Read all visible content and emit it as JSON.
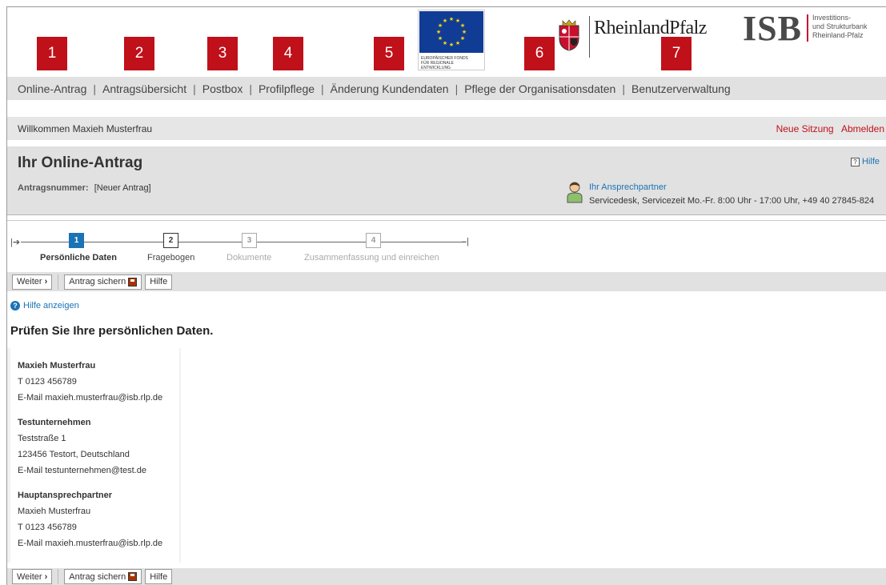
{
  "logos": {
    "eu_text_line1": "EUROPÄISCHER FONDS",
    "eu_text_line2": "FÜR REGIONALE ENTWICKLUNG",
    "rlp_name": "RheinlandPfalz",
    "isb_name": "ISB",
    "isb_sub_line1": "Investitions-",
    "isb_sub_line2": "und Strukturbank",
    "isb_sub_line3": "Rheinland-Pfalz"
  },
  "badges": [
    "1",
    "2",
    "3",
    "4",
    "5",
    "6",
    "7"
  ],
  "nav": {
    "items": [
      "Online-Antrag",
      "Antragsübersicht",
      "Postbox",
      "Profilpflege",
      "Änderung Kundendaten",
      "Pflege der Organisationsdaten",
      "Benutzerverwaltung"
    ],
    "separator": "|"
  },
  "welcome": {
    "text": "Willkommen Maxieh Musterfrau",
    "new_session": "Neue Sitzung",
    "logout": "Abmelden"
  },
  "antrag": {
    "title": "Ihr Online-Antrag",
    "help_label": "Hilfe",
    "number_label": "Antragsnummer:",
    "number_value": "[Neuer Antrag]",
    "contact_label": "Ihr Ansprechpartner",
    "contact_info": "Servicedesk, Servicezeit Mo.-Fr. 8:00 Uhr - 17:00 Uhr, +49 40 27845-824"
  },
  "steps": [
    {
      "num": "1",
      "label": "Persönliche Daten",
      "state": "active"
    },
    {
      "num": "2",
      "label": "Fragebogen",
      "state": "done"
    },
    {
      "num": "3",
      "label": "Dokumente",
      "state": "off"
    },
    {
      "num": "4",
      "label": "Zusammenfassung und einreichen",
      "state": "off"
    }
  ],
  "toolbar": {
    "next_label": "Weiter",
    "next_glyph": "›",
    "save_label": "Antrag sichern",
    "help_label": "Hilfe"
  },
  "help_link": "Hilfe anzeigen",
  "heading": "Prüfen Sie Ihre persönlichen Daten.",
  "person": {
    "name": "Maxieh Musterfrau",
    "phone": "T 0123 456789",
    "email": "E-Mail maxieh.musterfrau@isb.rlp.de"
  },
  "company": {
    "name": "Testunternehmen",
    "street": "Teststraße 1",
    "city": "123456 Testort, Deutschland",
    "email": "E-Mail testunternehmen@test.de"
  },
  "main_contact": {
    "title": "Hauptansprechpartner",
    "name": "Maxieh Musterfrau",
    "phone": "T 0123 456789",
    "email": "E-Mail maxieh.musterfrau@isb.rlp.de"
  },
  "colors": {
    "badge_red": "#c0101a",
    "link_blue": "#1a73b5",
    "bar_gray": "#e1e1e1",
    "eu_blue": "#103c96",
    "eu_star": "#ffdd00"
  }
}
